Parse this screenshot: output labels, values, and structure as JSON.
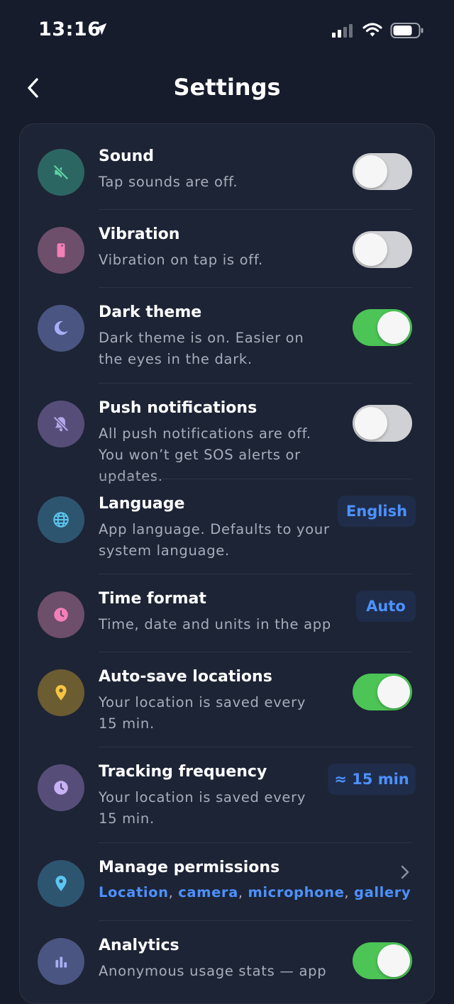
{
  "status_bar": {
    "time": "13:16"
  },
  "header": {
    "title": "Settings"
  },
  "colors": {
    "accent": "#4d91ff",
    "toggle_on": "#4cc456",
    "toggle_off": "#d0d1d4"
  },
  "settings": [
    {
      "title": "Sound",
      "desc": "Tap sounds are off.",
      "icon": "muted-speaker-icon",
      "control": "toggle",
      "on": false
    },
    {
      "title": "Vibration",
      "desc": "Vibration on tap is off.",
      "icon": "phone-vibrate-icon",
      "control": "toggle",
      "on": false
    },
    {
      "title": "Dark theme",
      "desc": "Dark theme is on. Easier on the eyes in the dark.",
      "icon": "moon-icon",
      "control": "toggle",
      "on": true
    },
    {
      "title": "Push notifications",
      "desc": "All push notifications are off. You won’t get SOS alerts or updates.",
      "icon": "bell-off-icon",
      "control": "toggle",
      "on": false
    },
    {
      "title": "Language",
      "desc": "App language. Defaults to your system language.",
      "icon": "globe-icon",
      "control": "chip",
      "value": "English"
    },
    {
      "title": "Time format",
      "desc": "Time, date and units in the app",
      "icon": "clock-icon",
      "control": "chip",
      "value": "Auto"
    },
    {
      "title": "Auto-save locations",
      "desc": "Your location is saved every 15 min.",
      "icon": "location-pin-icon",
      "control": "toggle",
      "on": true
    },
    {
      "title": "Tracking frequency",
      "desc": "Your location is saved every 15 min.",
      "icon": "clock-icon",
      "control": "chip",
      "value": "≈ 15 min"
    },
    {
      "title": "Manage permissions",
      "links": [
        "Location",
        "camera",
        "microphone",
        "gallery"
      ],
      "icon": "location-pin-icon",
      "control": "chevron"
    },
    {
      "title": "Analytics",
      "desc": "Anonymous usage stats — app",
      "icon": "bar-chart-icon",
      "control": "toggle",
      "on": true
    }
  ]
}
